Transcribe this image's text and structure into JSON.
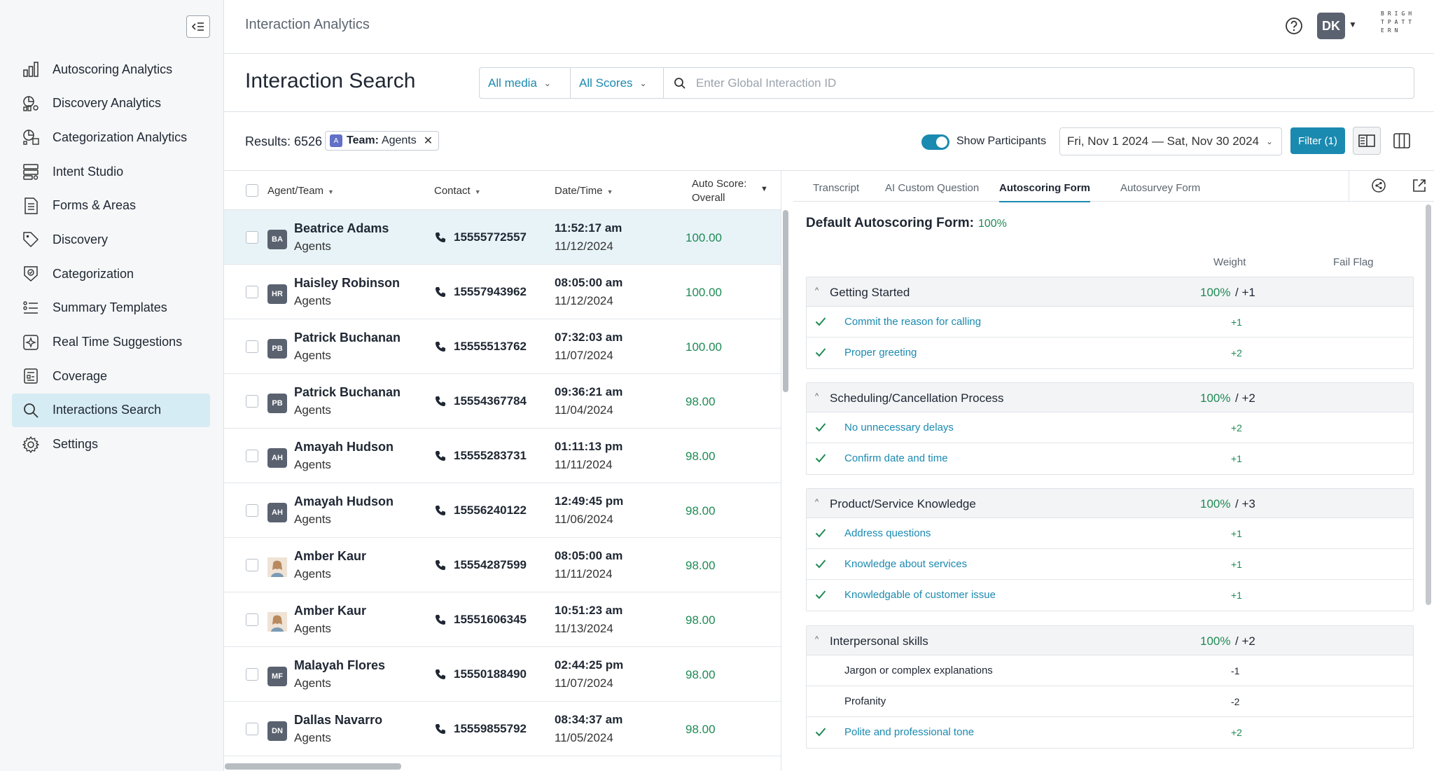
{
  "sidebar": {
    "items": [
      {
        "label": "Autoscoring Analytics",
        "icon": "bar-chart-icon"
      },
      {
        "label": "Discovery Analytics",
        "icon": "discovery-chart-icon"
      },
      {
        "label": "Categorization Analytics",
        "icon": "categorization-chart-icon"
      },
      {
        "label": "Intent Studio",
        "icon": "intent-icon"
      },
      {
        "label": "Forms & Areas",
        "icon": "form-icon"
      },
      {
        "label": "Discovery",
        "icon": "tag-icon"
      },
      {
        "label": "Categorization",
        "icon": "categorization-icon"
      },
      {
        "label": "Summary Templates",
        "icon": "summary-icon"
      },
      {
        "label": "Real Time Suggestions",
        "icon": "suggestion-icon"
      },
      {
        "label": "Coverage",
        "icon": "coverage-icon"
      },
      {
        "label": "Interactions Search",
        "icon": "search-icon",
        "active": true
      },
      {
        "label": "Settings",
        "icon": "gear-icon"
      }
    ]
  },
  "header": {
    "app_title": "Interaction Analytics",
    "user_initials": "DK",
    "brand_logo": "BRIGHTPATTERN"
  },
  "search": {
    "page_title": "Interaction Search",
    "media_filter": "All media",
    "score_filter": "All Scores",
    "placeholder": "Enter Global Interaction ID"
  },
  "results": {
    "count_label": "Results: 6526",
    "chip_badge": "A",
    "chip_key": "Team:",
    "chip_value": "Agents",
    "toggle_label": "Show Participants",
    "date_range": "Fri, Nov 1 2024 — Sat, Nov 30 2024",
    "filter_button": "Filter (1)"
  },
  "table": {
    "headers": {
      "agent": "Agent/Team",
      "contact": "Contact",
      "datetime": "Date/Time",
      "score_line1": "Auto Score:",
      "score_line2": "Overall"
    },
    "rows": [
      {
        "initials": "BA",
        "name": "Beatrice Adams",
        "team": "Agents",
        "phone": "15555772557",
        "time": "11:52:17 am",
        "date": "11/12/2024",
        "score": "100.00",
        "selected": true
      },
      {
        "initials": "HR",
        "name": "Haisley Robinson",
        "team": "Agents",
        "phone": "15557943962",
        "time": "08:05:00 am",
        "date": "11/12/2024",
        "score": "100.00"
      },
      {
        "initials": "PB",
        "name": "Patrick Buchanan",
        "team": "Agents",
        "phone": "15555513762",
        "time": "07:32:03 am",
        "date": "11/07/2024",
        "score": "100.00"
      },
      {
        "initials": "PB",
        "name": "Patrick Buchanan",
        "team": "Agents",
        "phone": "15554367784",
        "time": "09:36:21 am",
        "date": "11/04/2024",
        "score": "98.00"
      },
      {
        "initials": "AH",
        "name": "Amayah Hudson",
        "team": "Agents",
        "phone": "15555283731",
        "time": "01:11:13 pm",
        "date": "11/11/2024",
        "score": "98.00"
      },
      {
        "initials": "AH",
        "name": "Amayah Hudson",
        "team": "Agents",
        "phone": "15556240122",
        "time": "12:49:45 pm",
        "date": "11/06/2024",
        "score": "98.00"
      },
      {
        "initials": "",
        "name": "Amber Kaur",
        "team": "Agents",
        "phone": "15554287599",
        "time": "08:05:00 am",
        "date": "11/11/2024",
        "score": "98.00",
        "photo": true
      },
      {
        "initials": "",
        "name": "Amber Kaur",
        "team": "Agents",
        "phone": "15551606345",
        "time": "10:51:23 am",
        "date": "11/13/2024",
        "score": "98.00",
        "photo": true
      },
      {
        "initials": "MF",
        "name": "Malayah Flores",
        "team": "Agents",
        "phone": "15550188490",
        "time": "02:44:25 pm",
        "date": "11/07/2024",
        "score": "98.00"
      },
      {
        "initials": "DN",
        "name": "Dallas Navarro",
        "team": "Agents",
        "phone": "15559855792",
        "time": "08:34:37 am",
        "date": "11/05/2024",
        "score": "98.00"
      }
    ]
  },
  "panel": {
    "tabs": [
      "Transcript",
      "AI Custom Question",
      "Autoscoring Form",
      "Autosurvey Form"
    ],
    "active_tab": 2,
    "form_title": "Default Autoscoring Form:",
    "form_score": "100%",
    "col_weight": "Weight",
    "col_fail": "Fail Flag",
    "sections": [
      {
        "name": "Getting Started",
        "pct": "100%",
        "weight": "/ +1",
        "questions": [
          {
            "text": "Commit the reason for calling",
            "weight": "+1",
            "checked": true
          },
          {
            "text": "Proper greeting",
            "weight": "+2",
            "checked": true
          }
        ]
      },
      {
        "name": "Scheduling/Cancellation Process",
        "pct": "100%",
        "weight": "/ +2",
        "questions": [
          {
            "text": "No unnecessary delays",
            "weight": "+2",
            "checked": true
          },
          {
            "text": "Confirm date and time",
            "weight": "+1",
            "checked": true
          }
        ]
      },
      {
        "name": "Product/Service Knowledge",
        "pct": "100%",
        "weight": "/ +3",
        "questions": [
          {
            "text": "Address questions",
            "weight": "+1",
            "checked": true
          },
          {
            "text": "Knowledge about services",
            "weight": "+1",
            "checked": true
          },
          {
            "text": "Knowledgable of customer issue",
            "weight": "+1",
            "checked": true
          }
        ]
      },
      {
        "name": "Interpersonal skills",
        "pct": "100%",
        "weight": "/ +2",
        "questions": [
          {
            "text": "Jargon or complex explanations",
            "weight": "-1",
            "checked": false
          },
          {
            "text": "Profanity",
            "weight": "-2",
            "checked": false
          },
          {
            "text": "Polite and professional tone",
            "weight": "+2",
            "checked": true
          }
        ]
      }
    ]
  }
}
